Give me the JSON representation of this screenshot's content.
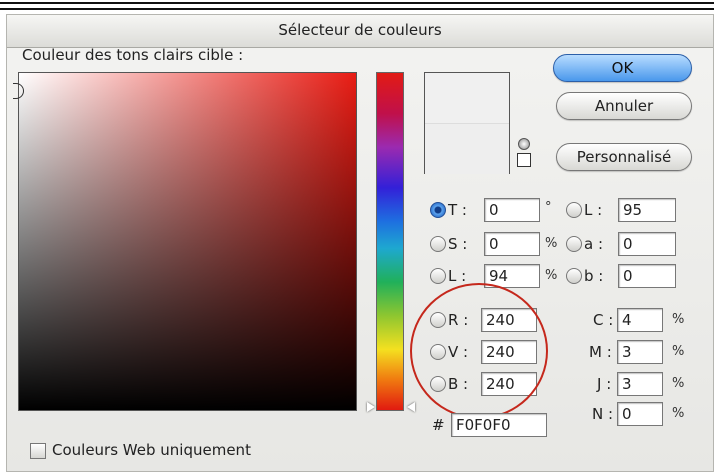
{
  "dialog": {
    "title": "Sélecteur de couleurs"
  },
  "picker": {
    "label": "Couleur des tons clairs cible :"
  },
  "buttons": {
    "ok": "OK",
    "cancel": "Annuler",
    "custom": "Personnalisé"
  },
  "hsb": [
    {
      "label": "T :",
      "value": "0",
      "unit": "°",
      "selected": true
    },
    {
      "label": "S :",
      "value": "0",
      "unit": "%",
      "selected": false
    },
    {
      "label": "L :",
      "value": "94",
      "unit": "%",
      "selected": false
    }
  ],
  "lab": [
    {
      "label": "L :",
      "value": "95"
    },
    {
      "label": "a :",
      "value": "0"
    },
    {
      "label": "b :",
      "value": "0"
    }
  ],
  "rgb": [
    {
      "label": "R :",
      "value": "240"
    },
    {
      "label": "V :",
      "value": "240"
    },
    {
      "label": "B :",
      "value": "240"
    }
  ],
  "cmyk": [
    {
      "label": "C :",
      "value": "4",
      "unit": "%"
    },
    {
      "label": "M :",
      "value": "3",
      "unit": "%"
    },
    {
      "label": "J :",
      "value": "3",
      "unit": "%"
    },
    {
      "label": "N :",
      "value": "0",
      "unit": "%"
    }
  ],
  "hex": {
    "label": "#",
    "value": "F0F0F0"
  },
  "web_only": {
    "label": "Couleurs Web uniquement",
    "checked": false
  },
  "colors": {
    "current": "#F0F0F0",
    "previous": "#EEEEEE",
    "highlight_circle": "#C5281C",
    "ok_button": "#4A98EC"
  },
  "icons": {
    "gamut_warning": "gamut-warning-icon",
    "web_safe": "web-safe-cube-icon"
  }
}
